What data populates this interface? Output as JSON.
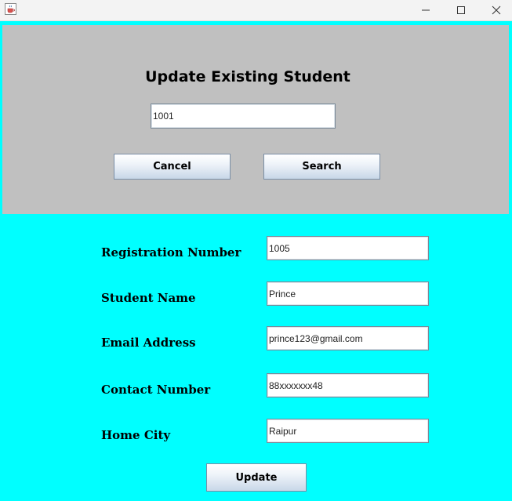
{
  "window": {
    "app_icon": "java-cup-icon",
    "controls": [
      "minimize-icon",
      "maximize-icon",
      "close-icon"
    ]
  },
  "search_panel": {
    "title": "Update Existing Student",
    "search_value": "1001",
    "cancel_label": "Cancel",
    "search_label": "Search"
  },
  "form": {
    "fields": [
      {
        "label": "Registration Number",
        "value": "1005"
      },
      {
        "label": "Student Name",
        "value": "Prince"
      },
      {
        "label": "Email Address",
        "value": "prince123@gmail.com"
      },
      {
        "label": "Contact Number",
        "value": "88xxxxxxx48"
      },
      {
        "label": "Home City",
        "value": "Raipur"
      }
    ],
    "update_label": "Update"
  },
  "colors": {
    "background": "#00ffff",
    "panel": "#c0c0c0"
  }
}
